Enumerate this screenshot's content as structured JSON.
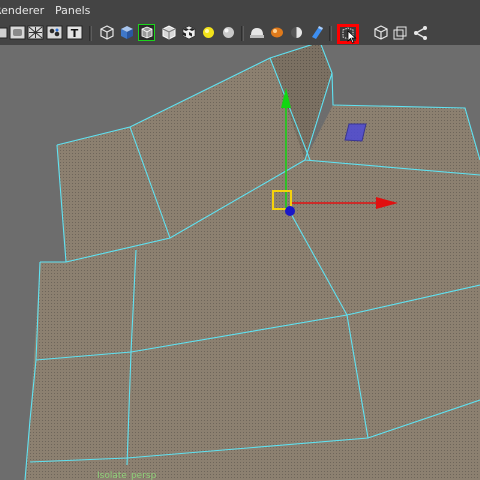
{
  "menubar": {
    "items": [
      {
        "label": "Renderer"
      },
      {
        "label": "Panels"
      }
    ]
  },
  "toolbar": {
    "buttons": [
      {
        "icon": "camera-icon"
      },
      {
        "icon": "image-plane-icon"
      },
      {
        "icon": "grid-icon"
      },
      {
        "icon": "film-gate-icon"
      },
      {
        "icon": "text-icon",
        "label": "T"
      },
      {
        "icon": "wireframe-cube-icon"
      },
      {
        "icon": "smooth-shade-cube-icon"
      },
      {
        "icon": "wireframe-on-shaded-icon"
      },
      {
        "icon": "xray-icon"
      },
      {
        "icon": "checker-texture-icon"
      },
      {
        "icon": "default-light-icon"
      },
      {
        "icon": "all-lights-icon"
      },
      {
        "icon": "shadows-icon"
      },
      {
        "icon": "screen-space-ambient-icon"
      },
      {
        "icon": "motion-blur-icon"
      },
      {
        "icon": "anti-alias-icon"
      },
      {
        "icon": "depth-of-field-icon"
      },
      {
        "icon": "xray-active-component-icon",
        "highlighted": true
      },
      {
        "icon": "isolate-select-icon"
      },
      {
        "icon": "bookmark-icon"
      },
      {
        "icon": "share-node-icon"
      }
    ]
  },
  "viewport": {
    "isolate_label": "Isolate",
    "camera_label": "persp",
    "colors": {
      "background": "#6d6d6d",
      "mesh_fill": "#8c8070",
      "wire": "#5fe2f2",
      "manip_x": "#e11010",
      "manip_y": "#11d611",
      "manip_center": "#f5d20c",
      "pivot": "#1a17c8",
      "highlight": "#ff0000"
    }
  }
}
